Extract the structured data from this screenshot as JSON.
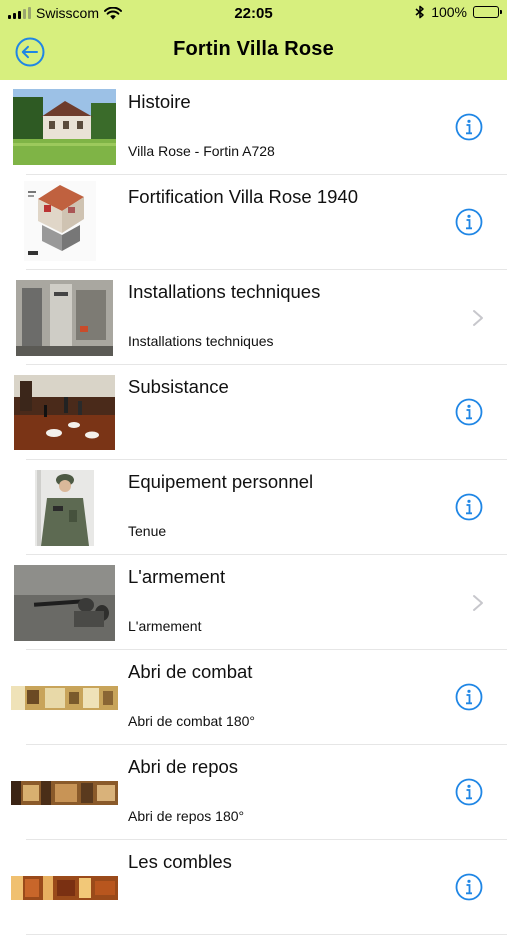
{
  "status_bar": {
    "carrier": "Swisscom",
    "time": "22:05",
    "battery": "100%"
  },
  "nav": {
    "title": "Fortin Villa Rose",
    "back_icon": "back-arrow-circle-icon"
  },
  "colors": {
    "nav_background": "#d7ef7e",
    "accent": "#1f86e5",
    "chevron": "#c7c7cc"
  },
  "items": [
    {
      "title": "Histoire",
      "subtitle": "Villa Rose - Fortin A728",
      "accessory": "info-icon"
    },
    {
      "title": "Fortification Villa Rose 1940",
      "subtitle": "",
      "accessory": "info-icon"
    },
    {
      "title": "Installations techniques",
      "subtitle": "Installations techniques",
      "accessory": "chevron-right-icon"
    },
    {
      "title": "Subsistance",
      "subtitle": "",
      "accessory": "info-icon"
    },
    {
      "title": "Equipement personnel",
      "subtitle": "Tenue",
      "accessory": "info-icon"
    },
    {
      "title": "L'armement",
      "subtitle": "L'armement",
      "accessory": "chevron-right-icon"
    },
    {
      "title": "Abri de combat",
      "subtitle": "Abri de combat 180°",
      "accessory": "info-icon"
    },
    {
      "title": "Abri de repos",
      "subtitle": "Abri de repos 180°",
      "accessory": "info-icon"
    },
    {
      "title": "Les combles",
      "subtitle": "",
      "accessory": "info-icon"
    }
  ]
}
